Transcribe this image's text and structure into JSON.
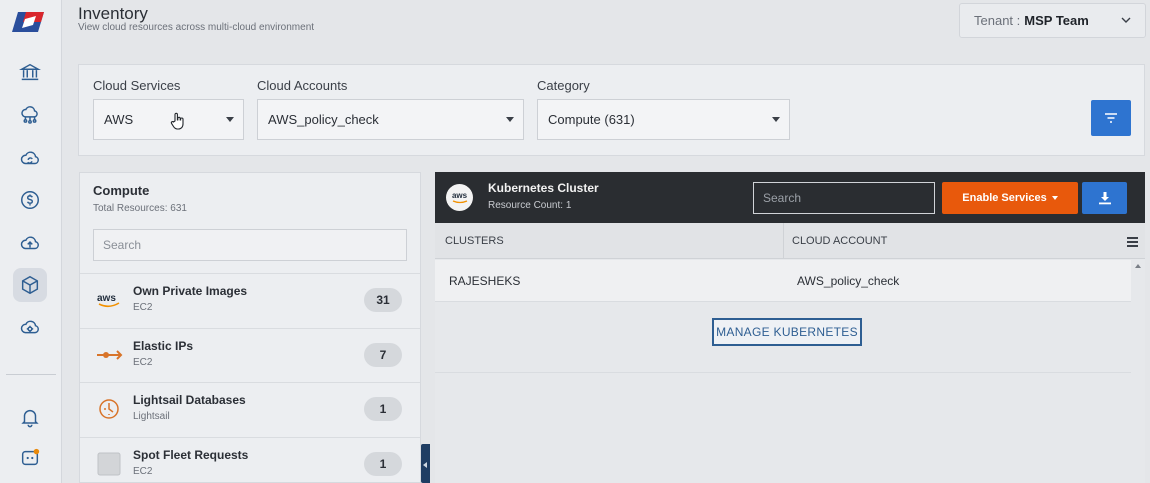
{
  "header": {
    "title": "Inventory",
    "subtitle": "View cloud resources across multi-cloud environment",
    "tenant_label": "Tenant :",
    "tenant_value": "MSP Team"
  },
  "sidebar": {
    "items": [
      {
        "icon": "bank-icon"
      },
      {
        "icon": "cloud-network-icon"
      },
      {
        "icon": "cloud-sync-icon"
      },
      {
        "icon": "dollar-icon"
      },
      {
        "icon": "cloud-upload-icon"
      },
      {
        "icon": "cube-icon",
        "active": true
      },
      {
        "icon": "cloud-settings-icon"
      }
    ],
    "bottom": [
      {
        "icon": "bell-icon"
      },
      {
        "icon": "chat-icon"
      }
    ]
  },
  "filters": {
    "cloud_services": {
      "label": "Cloud Services",
      "value": "AWS"
    },
    "cloud_accounts": {
      "label": "Cloud Accounts",
      "value": "AWS_policy_check"
    },
    "category": {
      "label": "Category",
      "value": "Compute (631)"
    }
  },
  "compute": {
    "title": "Compute",
    "total": "Total Resources: 631",
    "search_placeholder": "Search",
    "items": [
      {
        "name": "Own Private Images",
        "sub": "EC2",
        "count": "31",
        "icon": "aws-logo-icon"
      },
      {
        "name": "Elastic IPs",
        "sub": "EC2",
        "count": "7",
        "icon": "elastic-ip-icon"
      },
      {
        "name": "Lightsail Databases",
        "sub": "Lightsail",
        "count": "1",
        "icon": "lightsail-icon"
      },
      {
        "name": "Spot Fleet Requests",
        "sub": "EC2",
        "count": "1",
        "icon": "spot-fleet-icon"
      }
    ]
  },
  "kubernetes": {
    "badge": "aws",
    "title": "Kubernetes Cluster",
    "resource_count": "Resource Count: 1",
    "search_placeholder": "Search",
    "enable_label": "Enable Services",
    "columns": [
      "CLUSTERS",
      "CLOUD ACCOUNT"
    ],
    "rows": [
      {
        "cluster": "RAJESHEKS",
        "account": "AWS_policy_check"
      }
    ],
    "manage_label": "MANAGE KUBERNETES"
  },
  "colors": {
    "accent_blue": "#2e74d0",
    "enable_orange": "#e8590c",
    "dark_header": "#2a2d31"
  }
}
